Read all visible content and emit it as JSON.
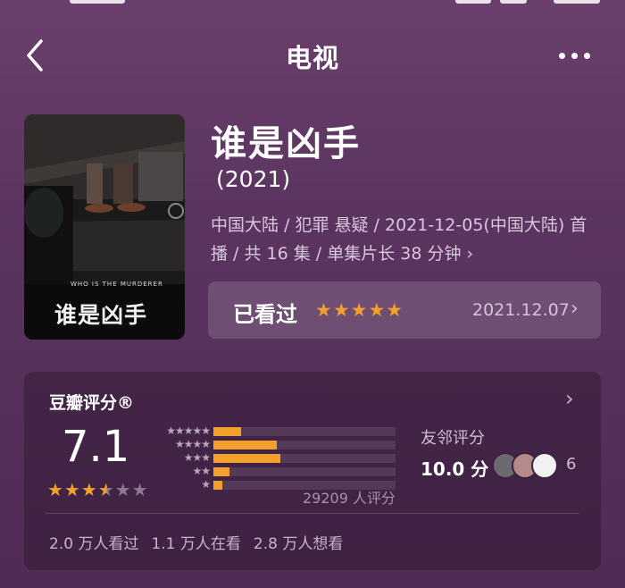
{
  "header": {
    "title": "电视",
    "back_icon": "chevron-left-icon",
    "more_icon": "more-dots-icon"
  },
  "show": {
    "title": "谁是凶手",
    "year": "(2021)",
    "meta_line1": "中国大陆 / 犯罪 悬疑 / 2021-12-05(中国大陆) 首",
    "meta_line2": "播 / 共 16 集 / 单集片长 38 分钟",
    "poster_caption_small": "WHO IS THE MURDERER",
    "poster_caption_big": "谁是凶手"
  },
  "watched": {
    "label": "已看过",
    "stars": "★★★★★",
    "date": "2021.12.07",
    "accent": "#f3a02d"
  },
  "rating": {
    "title": "豆瓣评分®",
    "score": "7.1",
    "stars_on": "★★★",
    "stars_half": "★",
    "stars_off": "★★",
    "count_text": "29209 人评分",
    "distribution": [
      {
        "stars": "★★★★★",
        "fraction": 0.15
      },
      {
        "stars": "★★★★",
        "fraction": 0.35
      },
      {
        "stars": "★★★",
        "fraction": 0.37
      },
      {
        "stars": "★★",
        "fraction": 0.09
      },
      {
        "stars": "★",
        "fraction": 0.05
      }
    ],
    "friends_label": "友邻评分",
    "friends_score": "10.0 分",
    "friends_count": "6",
    "stats": [
      "2.0 万人看过",
      "1.1 万人在看",
      "2.8 万人想看"
    ]
  }
}
